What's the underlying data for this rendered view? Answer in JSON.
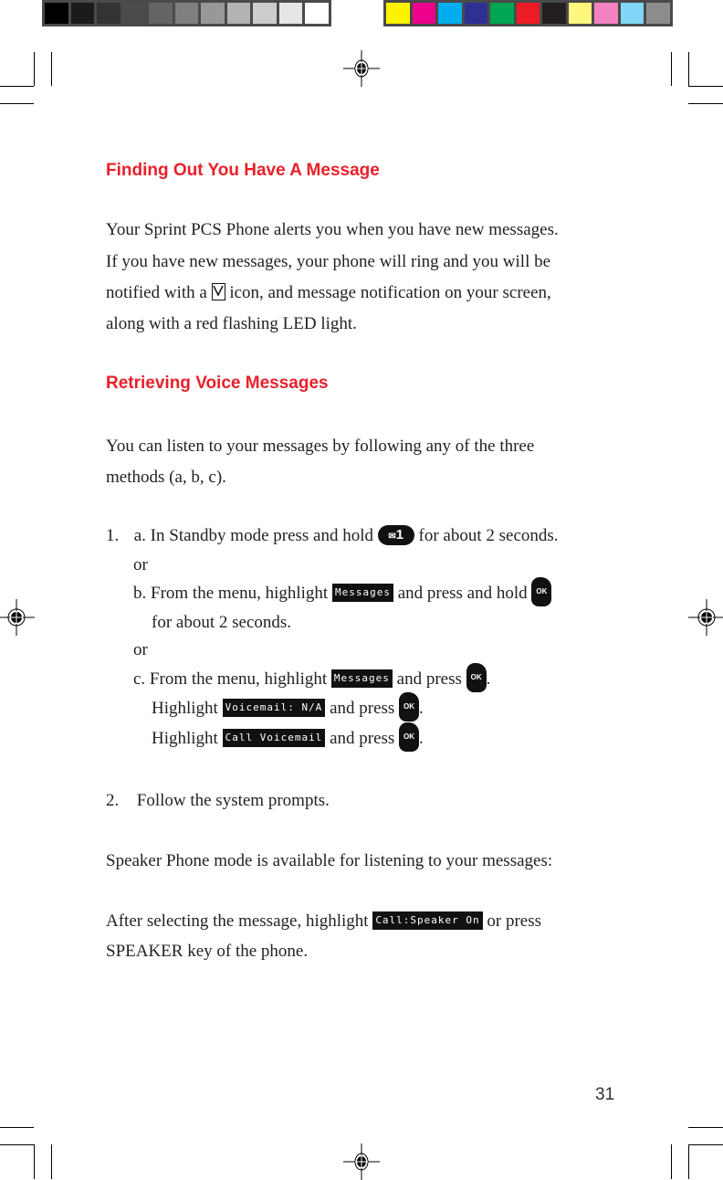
{
  "color_bars": {
    "grayscale": [
      "#000000",
      "#1b1b1b",
      "#333333",
      "#4b4b4b",
      "#646464",
      "#7f7f7f",
      "#989898",
      "#b3b3b3",
      "#cccccc",
      "#e6e6e6",
      "#ffffff"
    ],
    "colors": [
      "#fff200",
      "#ec008c",
      "#00aeef",
      "#2e3192",
      "#00a651",
      "#ed1c24",
      "#231f20",
      "#fff67e",
      "#f482c0",
      "#7fd6f7",
      "#8c8c8c"
    ]
  },
  "section1": {
    "heading": "Finding Out You Have A Message",
    "lines": [
      "Your Sprint PCS Phone alerts you when you have new messages.",
      "If you have new messages, your phone will ring and you will be"
    ],
    "line3_pre": "notified with a",
    "line3_icon": "envelope-icon",
    "line3_post": "icon, and message notification on your screen,",
    "line4": "along with a red flashing LED light."
  },
  "section2": {
    "heading": "Retrieving Voice Messages",
    "intro_lines": [
      "You can listen to your messages by following any of the three",
      "methods (a, b, c)."
    ],
    "step1": {
      "number": "1.",
      "a_pre": "a. In Standby mode press and hold",
      "a_key": "1",
      "a_post": "for about 2 seconds.",
      "or1": "or",
      "b_pre": "b. From the menu, highlight",
      "b_lcd": "Messages",
      "b_mid": "and press and hold",
      "b_key": "OK",
      "b_cont": "for about 2 seconds.",
      "or2": "or",
      "c_pre": "c. From the menu, highlight",
      "c_lcd": "Messages",
      "c_mid": "and press",
      "c_key": "OK",
      "c2_pre": "Highlight",
      "c2_lcd": "Voicemail: N/A",
      "c2_mid": "and press",
      "c2_key": "OK",
      "c3_pre": "Highlight",
      "c3_lcd": "Call Voicemail",
      "c3_mid": "and press",
      "c3_key": "OK",
      "period": "."
    },
    "step2": {
      "number": "2.",
      "text": "Follow the system prompts."
    },
    "speaker_line": "Speaker Phone mode is available for listening to your messages:",
    "after_pre": "After selecting the message, highlight",
    "after_lcd": "Call:Speaker On",
    "after_post": "or press",
    "after_line2": "SPEAKER key of the phone."
  },
  "page_number": "31"
}
